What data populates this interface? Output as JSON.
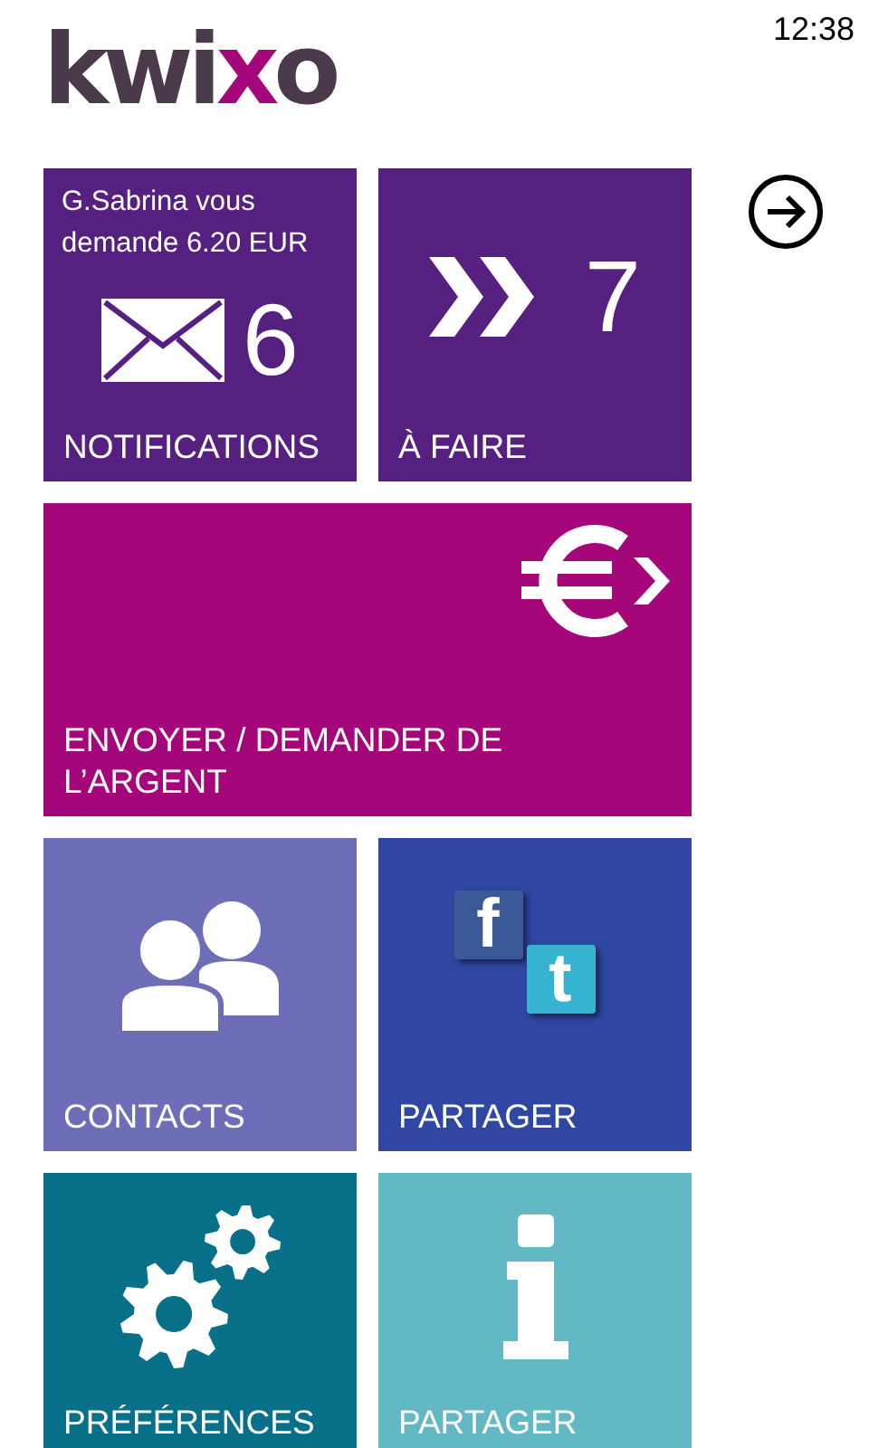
{
  "status_bar": {
    "time": "12:38"
  },
  "logo": {
    "parts": [
      {
        "text": "kwi",
        "accent": false
      },
      {
        "text": "x",
        "accent": true
      },
      {
        "text": "o",
        "accent": false
      }
    ]
  },
  "top_tiles": [
    {
      "kind": "notifications",
      "label": "NOTIFICATIONS",
      "color": "#55207f",
      "message": "G.Sabrina vous demande 6.20 EUR",
      "count": "6"
    },
    {
      "kind": "todo",
      "label": "À FAIRE",
      "color": "#55207f",
      "count": "7"
    }
  ],
  "send_tile": {
    "kind": "send",
    "label": "ENVOYER / DEMANDER DE L’ARGENT",
    "color": "#a5077a"
  },
  "middle_tiles": [
    {
      "kind": "contacts",
      "label": "CONTACTS",
      "color": "#6e6eb8"
    },
    {
      "kind": "share",
      "label": "PARTAGER",
      "color": "#2f47a2",
      "badges": [
        {
          "glyph": "f",
          "color": "#3b5998"
        },
        {
          "glyph": "t",
          "color": "#35b3d0"
        }
      ]
    }
  ],
  "bottom_tiles": [
    {
      "kind": "settings",
      "label": "PRÉFÉRENCES",
      "color": "#087089"
    },
    {
      "kind": "info",
      "label": "PARTAGER",
      "color": "#63b9c3"
    }
  ]
}
